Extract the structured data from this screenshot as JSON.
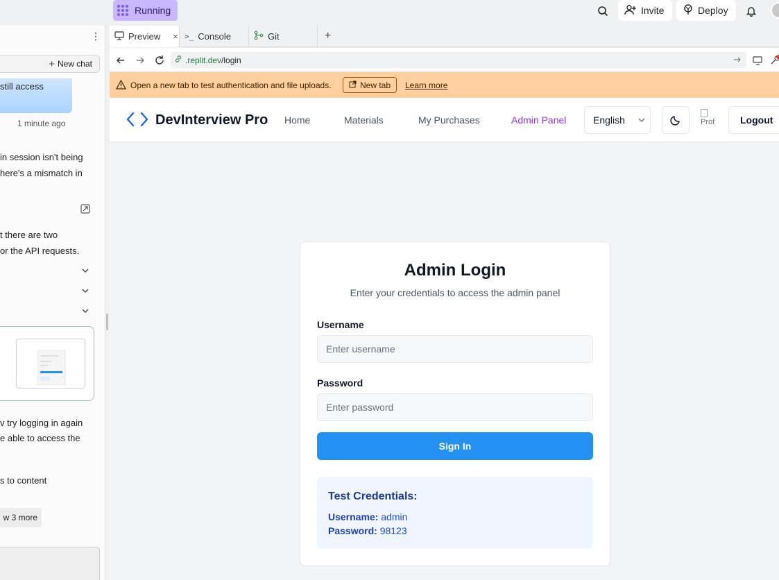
{
  "topbar": {
    "run_label": "Running",
    "invite_label": "Invite",
    "deploy_label": "Deploy"
  },
  "chat": {
    "new_chat_label": "New chat",
    "bubble_text": "still access",
    "time_label": "1 minute ago",
    "msg1_line1": "in session isn't being",
    "msg1_line2": "here's a mismatch in",
    "msg2_line1": "t there are two",
    "msg2_line2": "or the API requests.",
    "msg3_line1": "v try logging in again",
    "msg3_line2": "e able to access the",
    "msg4_line1": "s to content",
    "show_more_label": "w 3 more"
  },
  "tabs": [
    {
      "label": "Preview"
    },
    {
      "label": "Console"
    },
    {
      "label": "Git"
    }
  ],
  "url": {
    "host": ".replit.dev",
    "path": "/login"
  },
  "banner": {
    "text": "Open a new tab to test authentication and file uploads.",
    "new_tab_label": "New tab",
    "learn_more_label": "Learn more"
  },
  "app": {
    "brand": "DevInterview Pro",
    "nav": {
      "home": "Home",
      "materials": "Materials",
      "purchases": "My Purchases",
      "admin": "Admin Panel"
    },
    "language": "English",
    "profile_alt": "Prof",
    "logout_label": "Logout",
    "accent_color": "#9333ea"
  },
  "login": {
    "title": "Admin Login",
    "subtitle": "Enter your credentials to access the admin panel",
    "username_label": "Username",
    "username_placeholder": "Enter username",
    "password_label": "Password",
    "password_placeholder": "Enter password",
    "submit_label": "Sign In",
    "button_color": "#2490ef",
    "test_title": "Test Credentials:",
    "test_user_key": "Username:",
    "test_user_value": "admin",
    "test_pass_key": "Password:",
    "test_pass_value": "98123"
  }
}
